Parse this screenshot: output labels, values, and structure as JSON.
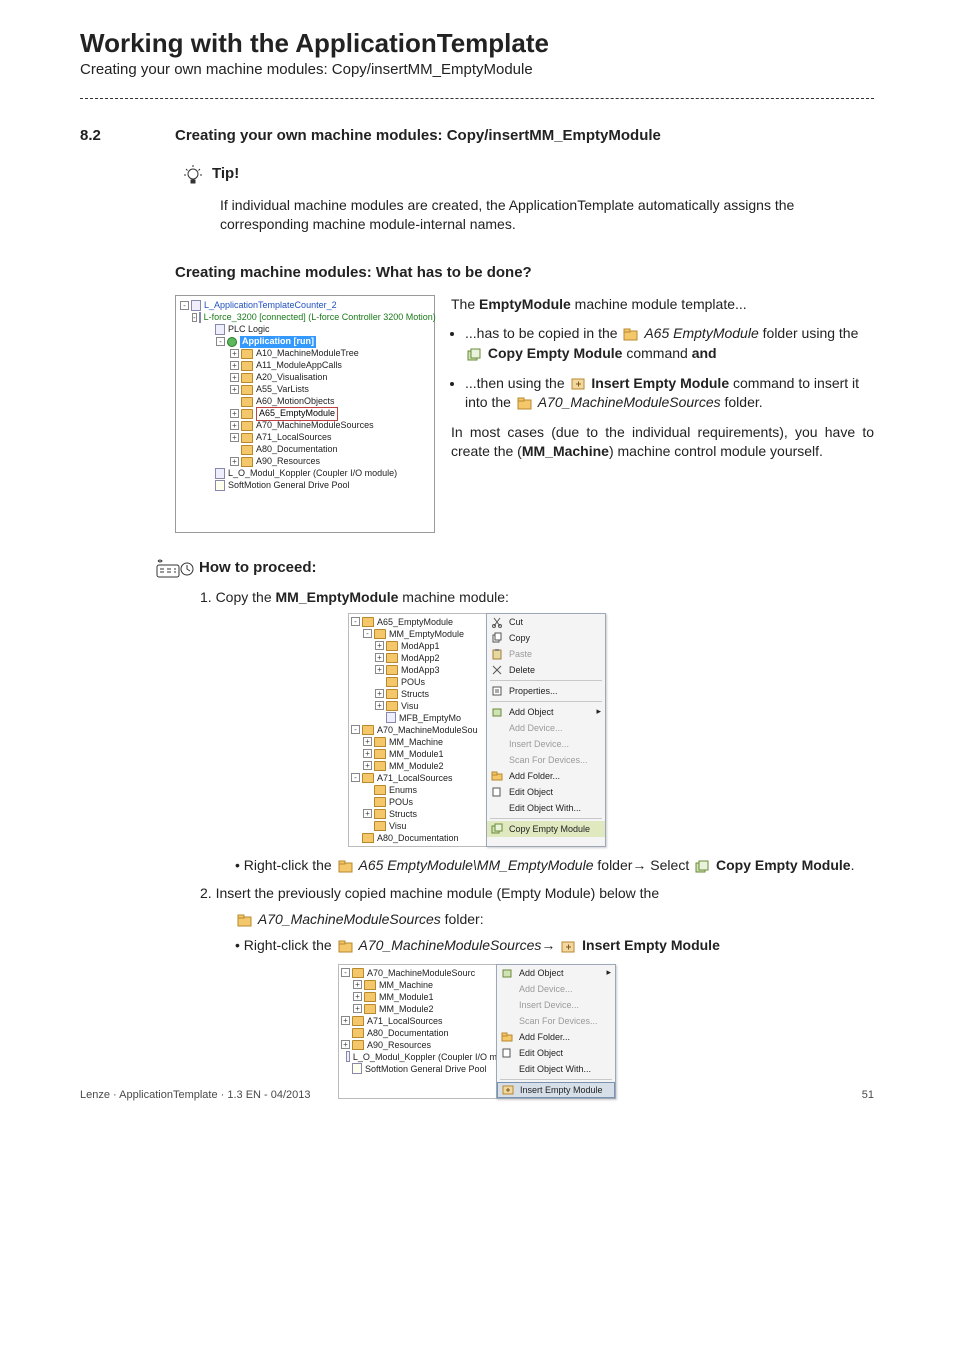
{
  "header": {
    "title": "Working with the ApplicationTemplate",
    "subtitle": "Creating your own machine modules: Copy/insertMM_EmptyModule"
  },
  "section": {
    "number": "8.2",
    "title": "Creating your own machine modules: Copy/insertMM_EmptyModule"
  },
  "tip": {
    "label": "Tip!",
    "body": "If individual machine modules are created, the ApplicationTemplate automatically assigns the corresponding machine module-internal names."
  },
  "subhead1": "Creating machine modules: What has to be done?",
  "tree1": {
    "root": "L_ApplicationTemplateCounter_2",
    "device": "L-force_3200 [connected] (L-force Controller 3200 Motion)",
    "plc": "PLC Logic",
    "app": "Application [run]",
    "items": [
      "A10_MachineModuleTree",
      "A11_ModuleAppCalls",
      "A20_Visualisation",
      "A55_VarLists",
      "A60_MotionObjects",
      "A65_EmptyModule",
      "A70_MachineModuleSources",
      "A71_LocalSources",
      "A80_Documentation",
      "A90_Resources"
    ],
    "coupler": "L_O_Modul_Koppler (Coupler I/O module)",
    "pool": "SoftMotion General Drive Pool"
  },
  "desc": {
    "intro_a": "The ",
    "intro_b": "EmptyModule",
    "intro_c": " machine module template...",
    "b1_a": "...has to be copied in the ",
    "b1_folder": "A65 EmptyModule",
    "b1_b": " folder using the ",
    "b1_cmd": "Copy Empty Module",
    "b1_c": " command ",
    "b1_d": "and",
    "b2_a": "...then using the ",
    "b2_cmd": "Insert Empty Module",
    "b2_b": "  command to insert it into the ",
    "b2_folder": "A70_MachineModuleSources",
    "b2_c": " folder.",
    "note_a": "In most cases (due to the individual requirements), you have to create the (",
    "note_b": "MM_Machine",
    "note_c": ") machine control module yourself."
  },
  "howto": {
    "title": "How to proceed:",
    "step1_a": "1.   Copy the ",
    "step1_b": "MM_EmptyModule",
    "step1_c": " machine module:",
    "step1_bullet_a": "Right-click the ",
    "step1_bullet_folder": "A65 EmptyModule\\MM_EmptyModule",
    "step1_bullet_b": " folder→ Select ",
    "step1_bullet_cmd": "Copy Empty Module",
    "step1_bullet_c": ".",
    "step2_a": "2.   Insert the previously copied machine module (Empty Module) below the",
    "step2_folder": "A70_MachineModuleSources",
    "step2_b": " folder:",
    "step2_bullet_a": "Right-click the ",
    "step2_bullet_folder": "A70_MachineModuleSources",
    "step2_bullet_arrow": "→",
    "step2_bullet_cmd": "Insert Empty Module"
  },
  "ctx1": {
    "tree": [
      "A65_EmptyModule",
      "MM_EmptyModule",
      "ModApp1",
      "ModApp2",
      "ModApp3",
      "POUs",
      "Structs",
      "Visu",
      "MFB_EmptyMo",
      "A70_MachineModuleSou",
      "MM_Machine",
      "MM_Module1",
      "MM_Module2",
      "A71_LocalSources",
      "Enums",
      "POUs",
      "Structs",
      "Visu",
      "A80_Documentation"
    ],
    "menu": [
      {
        "label": "Cut",
        "icon": "cut",
        "dis": false
      },
      {
        "label": "Copy",
        "icon": "copy",
        "dis": false
      },
      {
        "label": "Paste",
        "icon": "paste",
        "dis": true
      },
      {
        "label": "Delete",
        "icon": "del",
        "dis": false
      },
      {
        "sep": true
      },
      {
        "label": "Properties...",
        "icon": "prop",
        "dis": false
      },
      {
        "sep": true
      },
      {
        "label": "Add Object",
        "icon": "add",
        "dis": false,
        "arrow": true
      },
      {
        "label": "Add Device...",
        "dis": true
      },
      {
        "label": "Insert Device...",
        "dis": true
      },
      {
        "label": "Scan For Devices...",
        "dis": true
      },
      {
        "label": "Add Folder...",
        "icon": "fold",
        "dis": false
      },
      {
        "label": "Edit Object",
        "icon": "edit",
        "dis": false
      },
      {
        "label": "Edit Object With...",
        "dis": false
      },
      {
        "sep": true
      },
      {
        "label": "Copy Empty Module",
        "icon": "cem",
        "dis": false,
        "hl": true
      }
    ]
  },
  "ctx2": {
    "tree": [
      "A70_MachineModuleSourc",
      "MM_Machine",
      "MM_Module1",
      "MM_Module2",
      "A71_LocalSources",
      "A80_Documentation",
      "A90_Resources",
      "L_O_Modul_Koppler (Coupler I/O m",
      "SoftMotion General Drive Pool"
    ],
    "menu": [
      {
        "label": "Add Object",
        "icon": "add",
        "dis": false,
        "arrow": true
      },
      {
        "label": "Add Device...",
        "dis": true
      },
      {
        "label": "Insert Device...",
        "dis": true
      },
      {
        "label": "Scan For Devices...",
        "dis": true
      },
      {
        "label": "Add Folder...",
        "icon": "fold",
        "dis": false
      },
      {
        "label": "Edit Object",
        "icon": "edit",
        "dis": false
      },
      {
        "label": "Edit Object With...",
        "dis": false
      },
      {
        "sep": true
      },
      {
        "label": "Insert Empty Module",
        "icon": "iem",
        "dis": false,
        "hl2": true
      }
    ]
  },
  "footer": {
    "left": "Lenze · ApplicationTemplate · 1.3 EN - 04/2013",
    "right": "51"
  }
}
